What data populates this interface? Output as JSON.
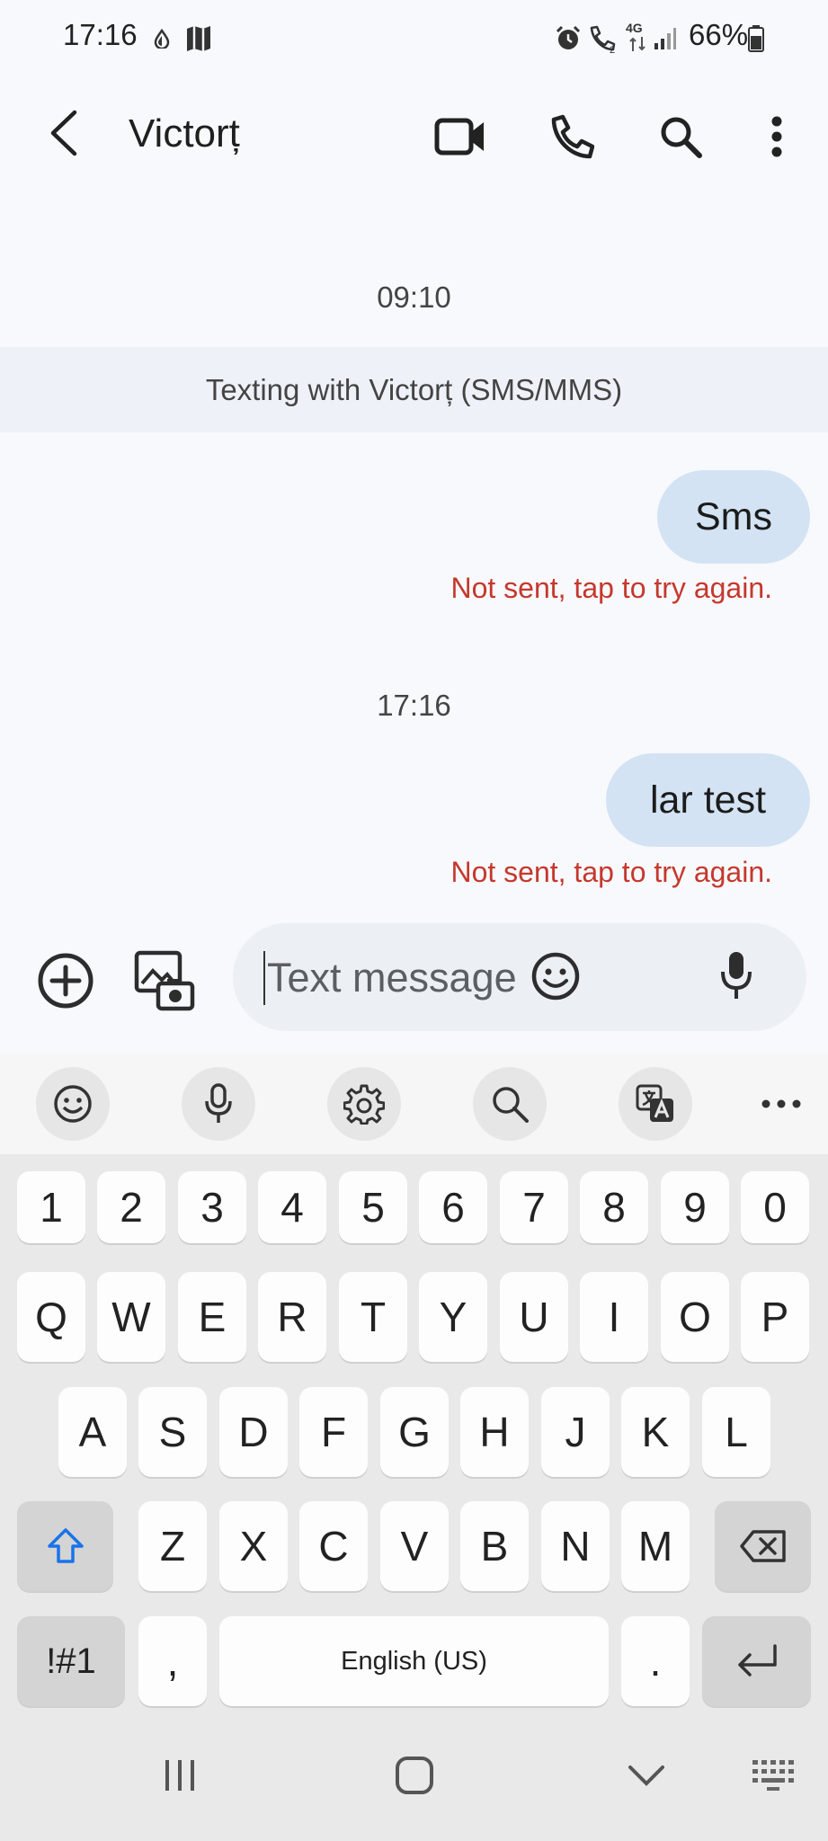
{
  "status_bar": {
    "time": "17:16",
    "battery": "66%",
    "network": "4G"
  },
  "header": {
    "contact_name": "Victorț",
    "icons": [
      "back-arrow-icon",
      "video-call-icon",
      "phone-icon",
      "search-icon",
      "more-vert-icon"
    ]
  },
  "conversation": {
    "timestamp_1": "09:10",
    "banner": "Texting with Victorț (SMS/MMS)",
    "timestamp_2": "17:16",
    "messages": [
      {
        "text": "Sms",
        "status": "Not sent, tap to try again."
      },
      {
        "text": "lar test",
        "status": "Not sent, tap to try again."
      }
    ]
  },
  "compose": {
    "placeholder": "Text message"
  },
  "keyboard": {
    "row_numbers": [
      "1",
      "2",
      "3",
      "4",
      "5",
      "6",
      "7",
      "8",
      "9",
      "0"
    ],
    "row_1": [
      "Q",
      "W",
      "E",
      "R",
      "T",
      "Y",
      "U",
      "I",
      "O",
      "P"
    ],
    "row_2": [
      "A",
      "S",
      "D",
      "F",
      "G",
      "H",
      "J",
      "K",
      "L"
    ],
    "row_3": [
      "Z",
      "X",
      "C",
      "V",
      "B",
      "N",
      "M"
    ],
    "symbols_key": "!#1",
    "comma_key": ",",
    "space_label": "English (US)",
    "period_key": "."
  },
  "colors": {
    "bubble": "#d3e3f3",
    "error": "#c5382d",
    "accent": "#1a73e8"
  }
}
